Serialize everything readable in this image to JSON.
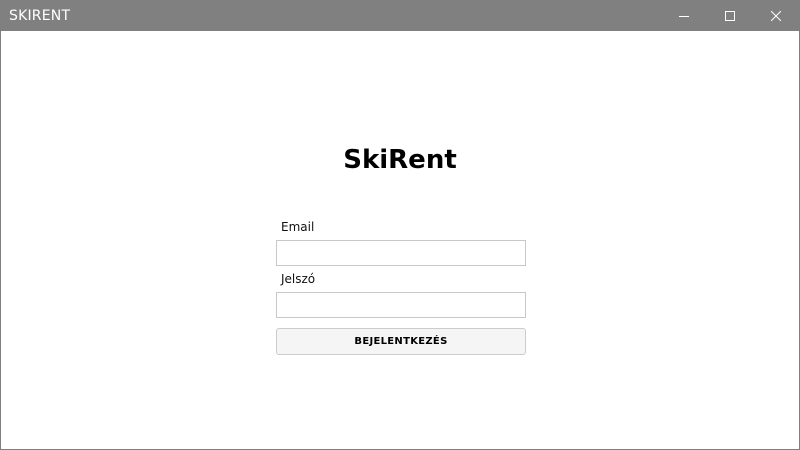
{
  "window": {
    "title": "SKIRENT",
    "controls": {
      "minimize": "minimize-icon",
      "maximize": "maximize-icon",
      "close": "close-icon"
    },
    "titlebar_color": "#808080"
  },
  "login": {
    "app_title": "SkiRent",
    "email_label": "Email",
    "email_value": "",
    "password_label": "Jelszó",
    "password_value": "",
    "submit_label": "BEJELENTKEZÉS"
  }
}
